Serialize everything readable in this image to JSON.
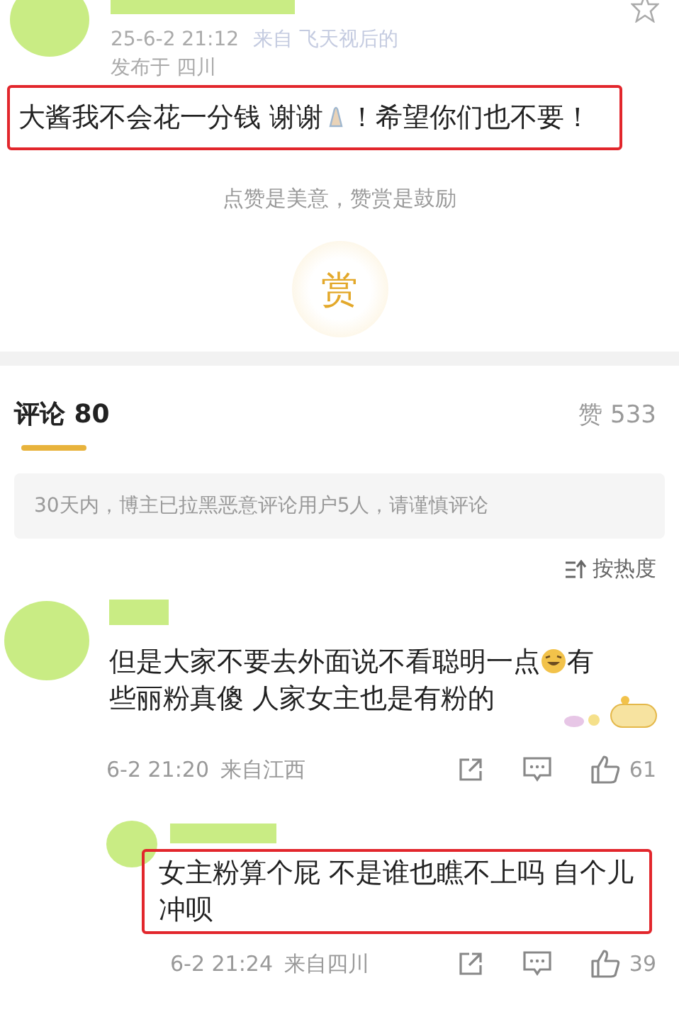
{
  "post": {
    "time": "25-6-2 21:12",
    "source": "来自 飞天视后的",
    "location": "发布于 四川",
    "text": "大酱我不会花一分钱 谢谢",
    "text_after": "！希望你们也不要！",
    "highlighted": true
  },
  "reward": {
    "caption": "点赞是美意，赞赏是鼓励",
    "button": "赏"
  },
  "comments_header": {
    "title": "评论 80",
    "likes": "赞 533",
    "notice": "30天内，博主已拉黑恶意评论用户5人，请谨慎评论",
    "sort": "按热度"
  },
  "comments": [
    {
      "kind": "comment",
      "text": "但是大家不要去外面说不看聪明一点",
      "text_after": "有些丽粉真傻  人家女主也是有粉的",
      "highlighted": false,
      "sticker": true,
      "time": "6-2 21:20",
      "location": "来自江西",
      "likes": "61"
    },
    {
      "kind": "reply",
      "text": "女主粉算个屁 不是谁也瞧不上吗 自个儿冲呗",
      "highlighted": true,
      "time": "6-2 21:24",
      "location": "来自四川",
      "likes": "39"
    }
  ]
}
